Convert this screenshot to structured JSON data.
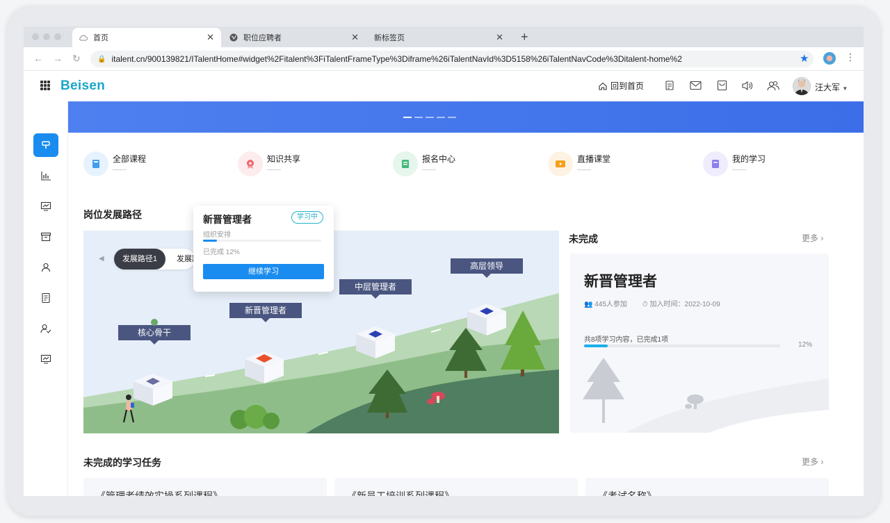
{
  "browser": {
    "tabs": [
      {
        "label": "首页",
        "active": true
      },
      {
        "label": "职位应聘者",
        "active": false
      },
      {
        "label": "新标签页",
        "active": false
      }
    ],
    "new_tab": "+",
    "url": "italent.cn/900139821/ITalentHome#widget%2Fitalent%3FiTalentFrameType%3Diframe%26iTalentNavId%3D5158%26iTalentNavCode%3Ditalent-home%2"
  },
  "header": {
    "logo": "Beisen",
    "home_link": "回到首页",
    "user_name": "汪大军"
  },
  "quick_links": [
    {
      "title": "全部课程",
      "sub": "——",
      "color": "#3f9df2",
      "bg": "#e6f2fd"
    },
    {
      "title": "知识共享",
      "sub": "——",
      "color": "#f0656a",
      "bg": "#fdeced"
    },
    {
      "title": "报名中心",
      "sub": "——",
      "color": "#44b87a",
      "bg": "#e6f6ec"
    },
    {
      "title": "直播课堂",
      "sub": "——",
      "color": "#f5a11c",
      "bg": "#fef3e2"
    },
    {
      "title": "我的学习",
      "sub": "——",
      "color": "#8c7ef0",
      "bg": "#efedfd"
    }
  ],
  "path_section": {
    "title": "岗位发展路径",
    "tabs": [
      "发展路径1",
      "发展路"
    ],
    "nodes": [
      "核心骨干",
      "新晋管理者",
      "中层管理者",
      "高层领导"
    ]
  },
  "popup": {
    "title": "新晋管理者",
    "badge": "学习中",
    "sub": "组织安排",
    "done": "已完成 12%",
    "progress": 12,
    "button": "继续学习"
  },
  "incomplete": {
    "title": "未完成",
    "more": "更多",
    "card_title": "新晋管理者",
    "participants": "445人参加",
    "join_time": "加入时间：2022-10-09",
    "progress_text": "共8项学习内容，已完成1项",
    "percent": "12%",
    "progress": 12
  },
  "tasks": {
    "title": "未完成的学习任务",
    "more": "更多",
    "items": [
      "《管理者绩效实操系列课程》",
      "《新员工培训系列课程》",
      "《考试名称》"
    ]
  },
  "colors": {
    "primary": "#1a8cf0",
    "brand": "#1aa6c9",
    "banner": "#4f80f0"
  }
}
